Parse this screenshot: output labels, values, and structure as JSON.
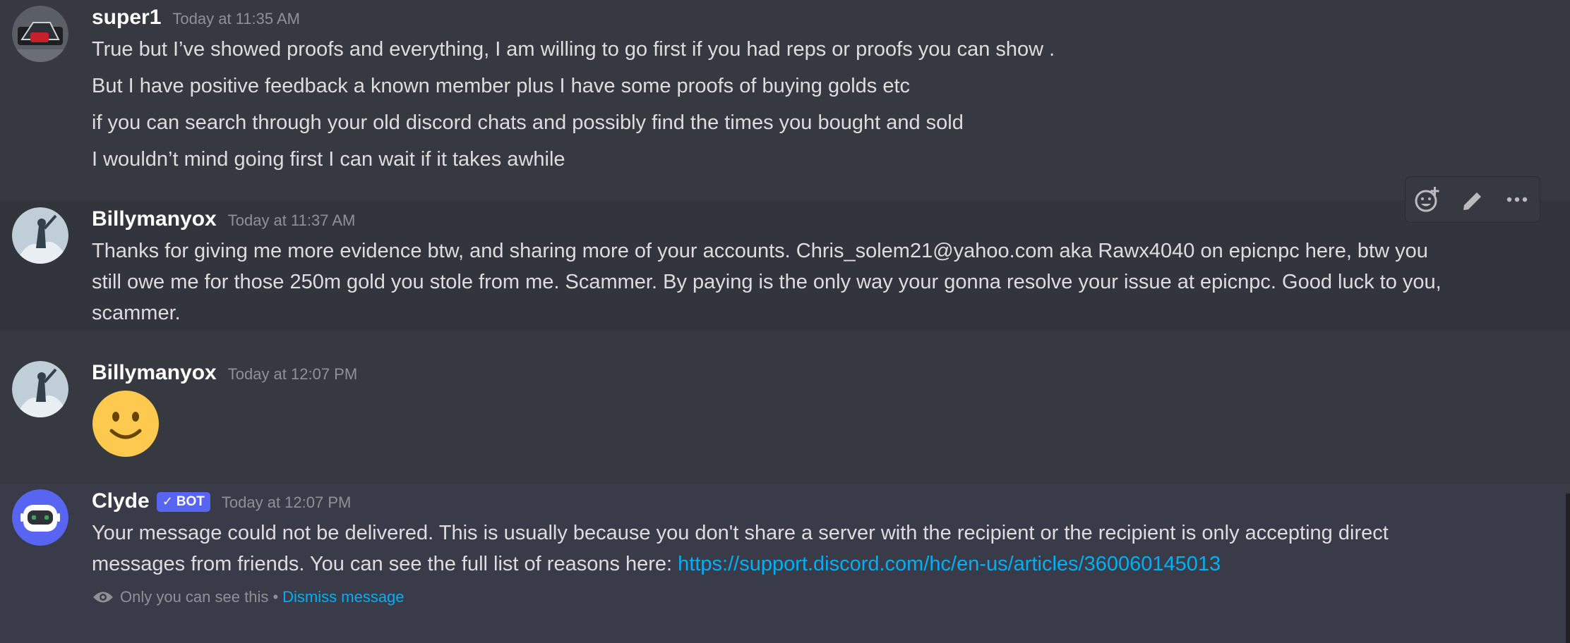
{
  "messages": [
    {
      "author": "super1",
      "timestamp": "Today at 11:35 AM",
      "lines": [
        "True but I’ve showed proofs and everything, I am willing to go first if you had reps or proofs you can show .",
        "But I have positive feedback a known member plus I have some proofs of buying golds etc",
        "if you can search through your old discord chats and possibly find the times you bought and sold",
        "I wouldn’t mind going first I can wait if it takes awhile"
      ]
    },
    {
      "author": "Billymanyox",
      "timestamp": "Today at 11:37 AM",
      "lines": [
        "Thanks for giving me more evidence btw, and sharing more of your accounts. Chris_solem21@yahoo.com  aka Rawx4040 on epicnpc here, btw you",
        "still owe me for those 250m gold you stole from me. Scammer. By paying is the only way your gonna resolve your issue at epicnpc. Good luck to you,",
        "scammer."
      ]
    },
    {
      "author": "Billymanyox",
      "timestamp": "Today at 12:07 PM",
      "emoji": "slightly-smiling-face"
    },
    {
      "author": "Clyde",
      "bot_tag": "BOT",
      "timestamp": "Today at 12:07 PM",
      "lines": [
        "Your message could not be delivered. This is usually because you don't share a server with the recipient or the recipient is only accepting direct",
        "messages from friends. You can see the full list of reasons here: "
      ],
      "link": "https://support.discord.com/hc/en-us/articles/360060145013",
      "ephemeral_note": "Only you can see this •",
      "dismiss_label": "Dismiss message"
    }
  ],
  "toolbar": {
    "icons": [
      "add-reaction-icon",
      "edit-icon",
      "more-icon"
    ]
  },
  "colors": {
    "background": "#36393f",
    "hover_row": "#32353b",
    "clyde_row": "#393c48",
    "bot_tag": "#5865f2",
    "link": "#00aff4",
    "muted": "#8e9297"
  }
}
